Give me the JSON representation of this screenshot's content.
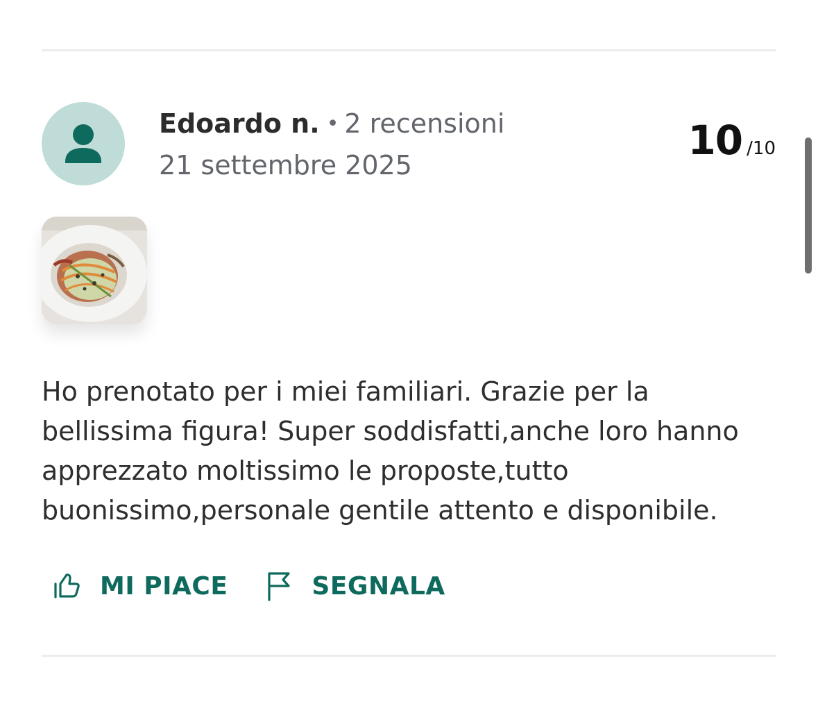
{
  "review": {
    "author": "Edoardo n.",
    "separator": "•",
    "review_count": "2 recensioni",
    "date": "21 settembre 2025",
    "score": "10",
    "score_max": "/10",
    "text": "Ho prenotato per i miei familiari. Grazie per la bellissima figura! Super soddisfatti,anche loro hanno apprezzato moltissimo le proposte,tutto buonissimo,personale gentile attento e disponibile."
  },
  "actions": {
    "like_label": "MI PIACE",
    "report_label": "SEGNALA"
  },
  "icons": {
    "avatar": "user-icon",
    "like": "thumbs-up-icon",
    "report": "flag-icon"
  },
  "colors": {
    "accent": "#0e6a5c",
    "avatar_bg": "#bfdcd8",
    "divider": "#ececec",
    "muted_text": "#62666c"
  }
}
